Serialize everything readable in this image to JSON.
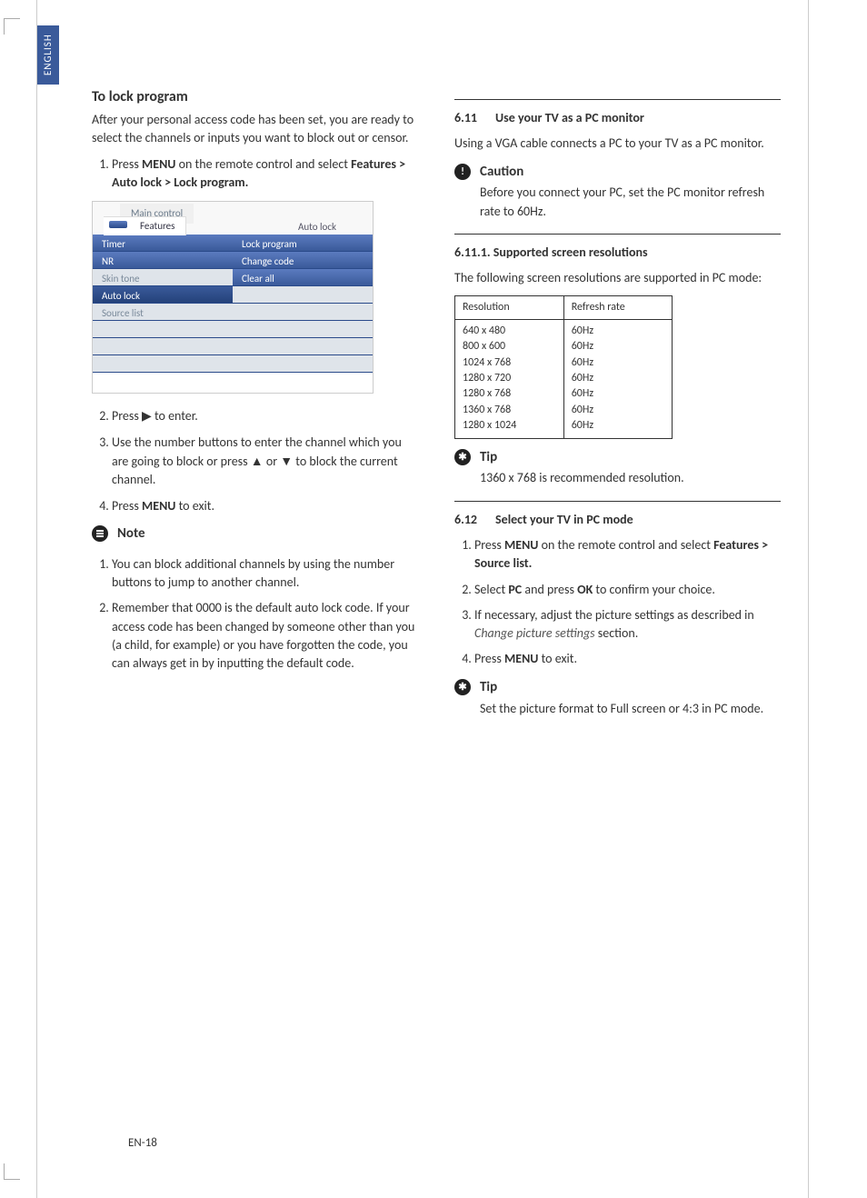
{
  "language_tab": "ENGLISH",
  "page_number": "EN-18",
  "left": {
    "title": "To lock program",
    "intro": "After your personal access code has been set, you are ready to select the channels or inputs you want to block out or censor.",
    "step1_a": "Press ",
    "step1_menu": "MENU",
    "step1_b": " on the remote control and select ",
    "step1_path": "Features > Auto lock > Lock program.",
    "osd": {
      "tab_back": "Main control",
      "tab_front": "Features",
      "head_right": "Auto lock",
      "left_items": [
        "Timer",
        "NR",
        "Skin tone",
        "Auto lock",
        "Source list",
        "",
        "",
        ""
      ],
      "right_items": [
        "Lock program",
        "Change code",
        "Clear all",
        "",
        "",
        "",
        "",
        ""
      ]
    },
    "step2_a": "Press ",
    "step2_b": " to enter.",
    "step3_a": "Use the number buttons to enter the channel which you are going to block or press ",
    "step3_b": " or ",
    "step3_c": " to block the current channel.",
    "step4_a": "Press ",
    "step4_menu": "MENU",
    "step4_b": " to exit.",
    "note_title": "Note",
    "note1": "You can block additional channels by using the number buttons to jump to another channel.",
    "note2": "Remember that 0000 is the default auto lock code.  If your access code has been changed by someone other than you (a child, for example) or you have forgotten the code, you can always get in by inputting the default code."
  },
  "right": {
    "sec611_num": "6.11",
    "sec611_title": "Use your TV as a PC monitor",
    "sec611_body": "Using a VGA cable connects a PC to your TV as a PC monitor.",
    "caution_title": "Caution",
    "caution_body": "Before you connect your PC, set the PC monitor refresh rate to 60Hz.",
    "sec6111_title": "6.11.1.  Supported screen resolutions",
    "sec6111_body": "The following screen resolutions are supported in PC mode:",
    "table": {
      "h1": "Resolution",
      "h2": "Refresh rate",
      "rows": [
        {
          "r": "640 x 480",
          "f": "60Hz"
        },
        {
          "r": "800 x 600",
          "f": "60Hz"
        },
        {
          "r": "1024 x 768",
          "f": "60Hz"
        },
        {
          "r": "1280 x 720",
          "f": "60Hz"
        },
        {
          "r": "1280 x 768",
          "f": "60Hz"
        },
        {
          "r": "1360 x 768",
          "f": "60Hz"
        },
        {
          "r": "1280 x 1024",
          "f": "60Hz"
        }
      ]
    },
    "tip1_title": "Tip",
    "tip1_body": "1360 x 768 is recommended resolution.",
    "sec612_num": "6.12",
    "sec612_title": "Select your TV in PC mode",
    "s612_1a": "Press ",
    "s612_1menu": "MENU",
    "s612_1b": " on the remote control and select ",
    "s612_1path": "Features > Source list.",
    "s612_2a": "Select ",
    "s612_2pc": "PC",
    "s612_2b": " and press ",
    "s612_2ok": "OK",
    "s612_2c": " to confirm your choice.",
    "s612_3a": "If necessary, adjust the picture settings as described in ",
    "s612_3i": "Change picture settings",
    "s612_3b": " section.",
    "s612_4a": "Press ",
    "s612_4menu": "MENU",
    "s612_4b": " to exit.",
    "tip2_title": "Tip",
    "tip2_body": "Set the picture format to Full screen or 4:3 in PC mode."
  },
  "glyphs": {
    "right": "▶",
    "up": "▲",
    "down": "▼"
  }
}
